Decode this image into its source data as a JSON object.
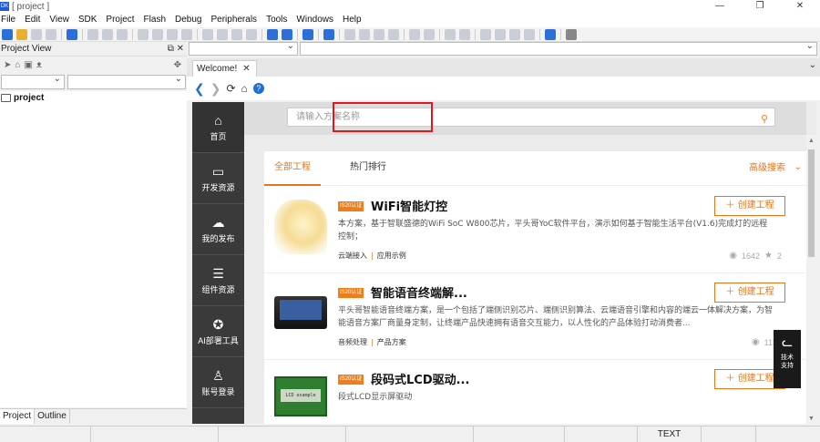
{
  "window": {
    "title": "[ project ]",
    "app_icon_label": "DK"
  },
  "menu": [
    "File",
    "Edit",
    "View",
    "SDK",
    "Project",
    "Flash",
    "Debug",
    "Peripherals",
    "Tools",
    "Windows",
    "Help"
  ],
  "project_view": {
    "title": "Project View",
    "tree": [
      {
        "label": "project"
      }
    ],
    "tabs": [
      {
        "label": "Project"
      },
      {
        "label": "Outline"
      }
    ]
  },
  "editor": {
    "tab_label": "Welcome!"
  },
  "web": {
    "sidenav": [
      {
        "label": "首页",
        "icon": "home-icon"
      },
      {
        "label": "开发资源",
        "icon": "code-folder-icon"
      },
      {
        "label": "我的发布",
        "icon": "cloud-upload-icon"
      },
      {
        "label": "组件资源",
        "icon": "component-icon"
      },
      {
        "label": "AI部署工具",
        "icon": "ai-icon"
      },
      {
        "label": "账号登录",
        "icon": "user-icon"
      }
    ],
    "search_placeholder": "请输入方案名称",
    "tabs": [
      {
        "label": "全部工程"
      },
      {
        "label": "热门排行"
      }
    ],
    "advanced_search": "高级搜索",
    "solutions": [
      {
        "badge": "IS20认证",
        "title": "WiFi智能灯控",
        "desc": "本方案，基于智联盛德的WiFi SoC W800芯片，平头哥YoC软件平台，演示如何基于智能生活平台(V1.6)完成灯的远程控制；",
        "tag1": "云端接入",
        "tag2": "应用示例",
        "views": "1642",
        "stars": "2",
        "create_label": "创建工程"
      },
      {
        "badge": "IS20认证",
        "title": "智能语音终端解...",
        "desc": "平头哥智能语音终端方案，是一个包括了端侧识别芯片、端侧识别算法、云端语音引擎和内容的端云一体解决方案，为智能语音方案厂商量身定制，让终端产品快速拥有语音交互能力，以人性化的产品体验打动消费者...",
        "tag1": "音频处理",
        "tag2": "产品方案",
        "views": "1138",
        "stars": "",
        "create_label": "创建工程"
      },
      {
        "badge": "IS20认证",
        "title": "段码式LCD驱动...",
        "desc": "段式LCD显示屏驱动",
        "tag1": "",
        "tag2": "",
        "views": "",
        "stars": "",
        "create_label": "创建工程"
      }
    ],
    "float_widget": {
      "line1": "技术",
      "line2": "支持"
    }
  },
  "status_bar": {
    "mode": "TEXT"
  },
  "colors": {
    "accent_orange": "#e8741c",
    "highlight_red": "#e2161c",
    "sidenav_bg": "#3a3a3a",
    "link_blue": "#1e6fd6"
  }
}
